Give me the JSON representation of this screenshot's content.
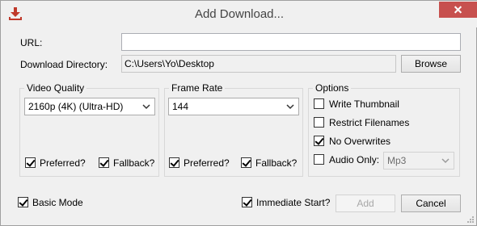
{
  "window": {
    "title": "Add Download..."
  },
  "url": {
    "label": "URL:",
    "value": ""
  },
  "directory": {
    "label": "Download Directory:",
    "value": "C:\\Users\\Yo\\Desktop",
    "browse_label": "Browse"
  },
  "video_quality": {
    "title": "Video Quality",
    "selected": "2160p (4K) (Ultra-HD)",
    "preferred_label": "Preferred?",
    "preferred_checked": true,
    "fallback_label": "Fallback?",
    "fallback_checked": true
  },
  "frame_rate": {
    "title": "Frame Rate",
    "selected": "144",
    "preferred_label": "Preferred?",
    "preferred_checked": true,
    "fallback_label": "Fallback?",
    "fallback_checked": true
  },
  "options": {
    "title": "Options",
    "write_thumbnail_label": "Write Thumbnail",
    "write_thumbnail_checked": false,
    "restrict_filenames_label": "Restrict Filenames",
    "restrict_filenames_checked": false,
    "no_overwrites_label": "No Overwrites",
    "no_overwrites_checked": true,
    "audio_only_label": "Audio Only:",
    "audio_only_checked": false,
    "audio_format": "Mp3"
  },
  "footer": {
    "basic_mode_label": "Basic Mode",
    "basic_mode_checked": true,
    "immediate_start_label": "Immediate Start?",
    "immediate_start_checked": true,
    "add_label": "Add",
    "cancel_label": "Cancel"
  },
  "colors": {
    "close_button": "#c7504e",
    "app_icon": "#c0392b"
  },
  "icons": {
    "app": "download-icon",
    "close": "close-icon",
    "combo": "chevron-down-icon"
  }
}
